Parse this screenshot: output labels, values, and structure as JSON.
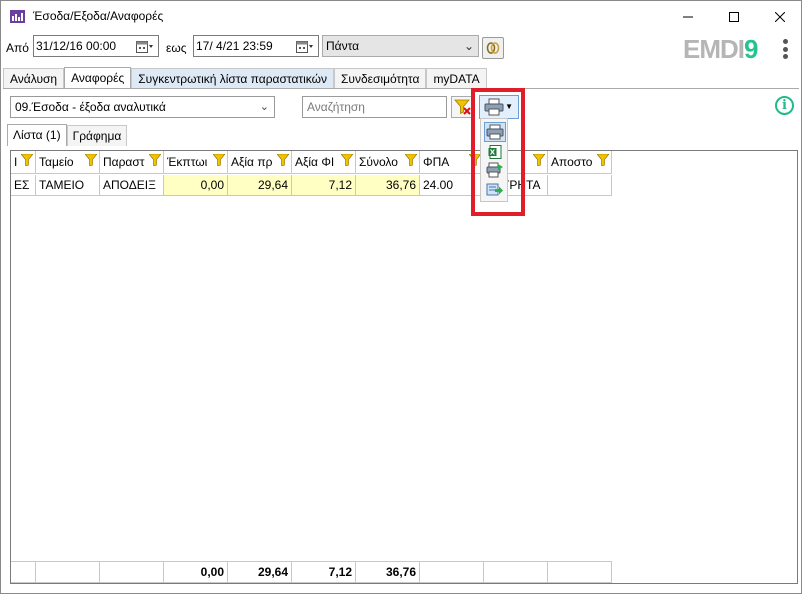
{
  "window": {
    "title": "Έσοδα/Εξοδα/Αναφορές",
    "controls": {
      "minimize": "—",
      "maximize": "☐",
      "close": "✕"
    }
  },
  "toolbar": {
    "from_label": "Από",
    "from_date": "31/12/16 00:00",
    "to_label": "εως",
    "to_date": "17/  4/21 23:59",
    "period_value": "Πάντα"
  },
  "logo": {
    "part1": "EMDI",
    "part2": "9"
  },
  "tabs": [
    {
      "label": "Ανάλυση",
      "active": false
    },
    {
      "label": "Αναφορές",
      "active": true
    },
    {
      "label": "Συγκεντρωτική λίστα παραστατικών",
      "active": false
    },
    {
      "label": "Συνδεσιμότητα",
      "active": false
    },
    {
      "label": "myDATA",
      "active": false
    }
  ],
  "report": {
    "selected": "09.Έσοδα - έξοδα αναλυτικά",
    "search_placeholder": "Αναζήτηση",
    "info_icon": "i"
  },
  "subtabs": [
    {
      "label": "Λίστα (1)",
      "active": true
    },
    {
      "label": "Γράφημα",
      "active": false
    }
  ],
  "grid": {
    "columns": [
      "Ι",
      "Ταμείο",
      "Παραστ",
      "Έκπτωι",
      "Αξία πρ",
      "Αξία ΦΙ",
      "Σύνολο",
      "ΦΠΑ",
      "",
      "Αποστο"
    ],
    "rows": [
      [
        "ΕΣ",
        "ΤΑΜΕΙΟ",
        "ΑΠΟΔΕΙΞ",
        "0,00",
        "29,64",
        "7,12",
        "36,76",
        "24.00",
        "ΤΡΗΤΑ",
        ""
      ]
    ],
    "totals": [
      "",
      "",
      "",
      "0,00",
      "29,64",
      "7,12",
      "36,76",
      "",
      "",
      ""
    ]
  },
  "dropdown": {
    "items": [
      "printer-icon",
      "excel-icon",
      "print-export-icon",
      "export-arrow-icon"
    ]
  },
  "colors": {
    "accent_green": "#25c48f",
    "highlight_red": "#e21d2b",
    "yellow_cell": "#ffffc4",
    "tab_highlight": "#dde9f5"
  }
}
